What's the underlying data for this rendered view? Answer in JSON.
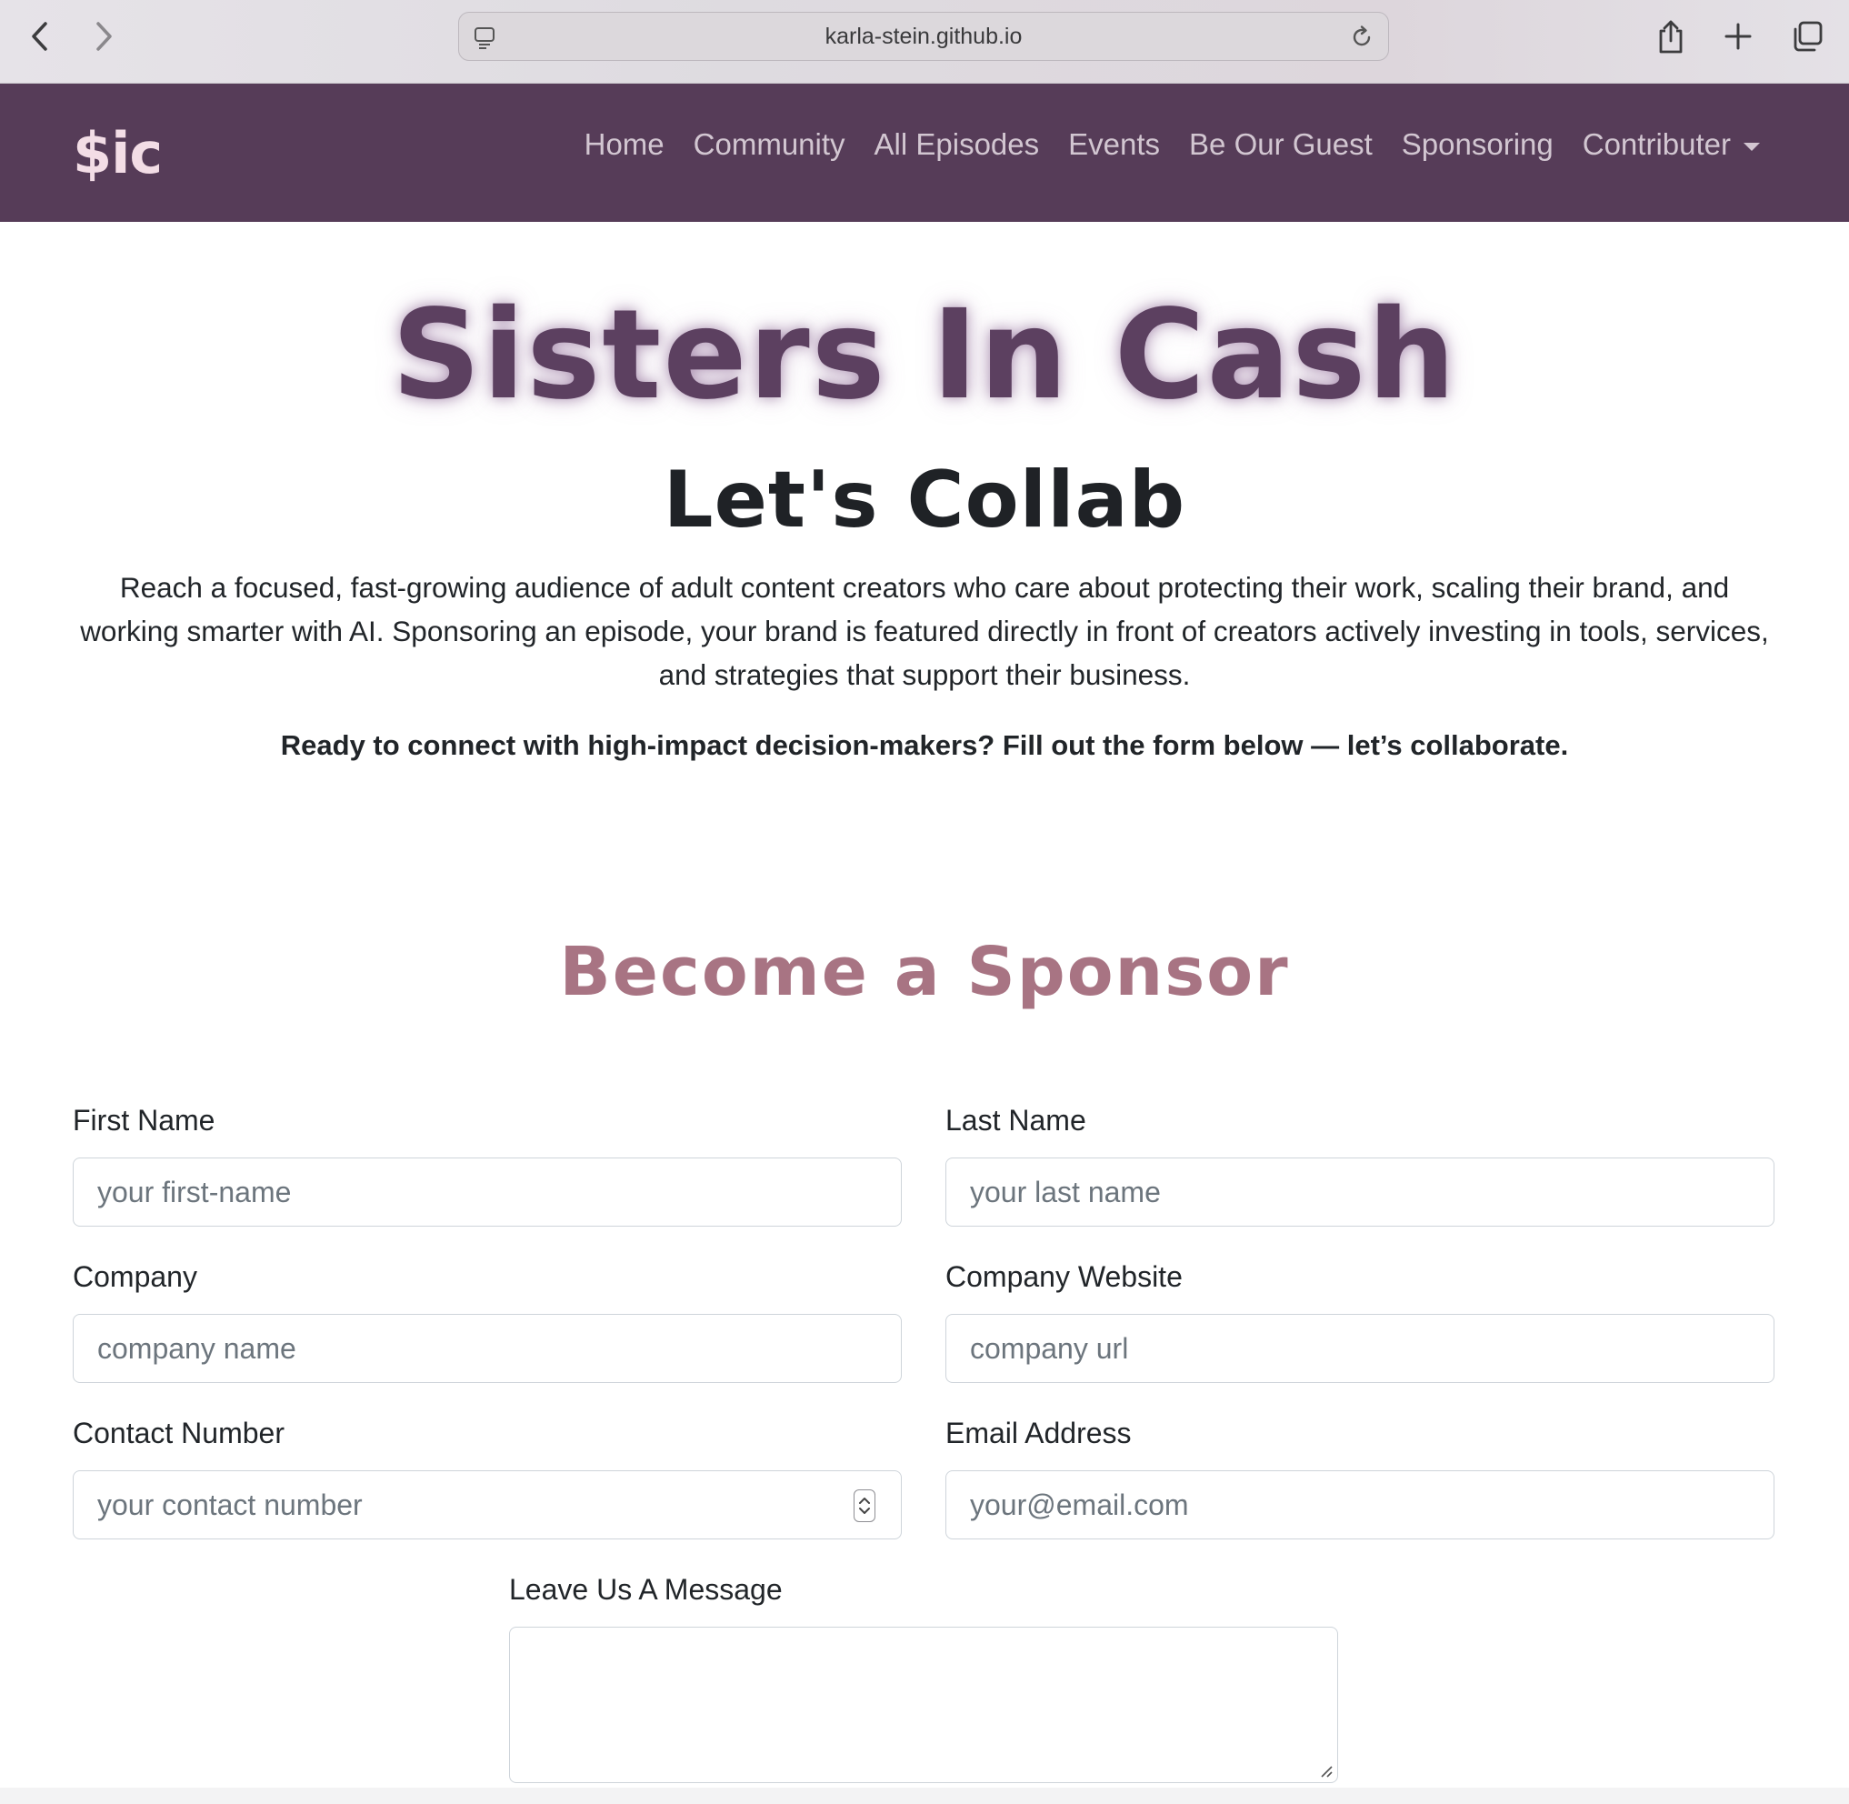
{
  "browser": {
    "url": "karla-stein.github.io",
    "icons": [
      "back-icon",
      "forward-icon",
      "page-icon",
      "reload-icon",
      "share-icon",
      "new-tab-icon",
      "tabs-icon"
    ]
  },
  "navbar": {
    "brand": "$ic",
    "links": [
      "Home",
      "Community",
      "All Episodes",
      "Events",
      "Be Our Guest",
      "Sponsoring",
      "Contributer"
    ],
    "colors": {
      "background": "#563c58",
      "brand": "#f3dde6",
      "link": "#d2c6d1"
    }
  },
  "hero": {
    "title": "Sisters In Cash",
    "subtitle": "Let's Collab",
    "intro": "Reach a focused, fast-growing audience of adult content creators who care about protecting their work, scaling their brand, and working smarter with AI. Sponsoring an episode, your brand is featured directly in front of creators actively investing in tools, services, and strategies that support their business.",
    "cta": "Ready to connect with high-impact decision-makers? Fill out the form below — let’s collaborate.",
    "colors": {
      "title": "#5c4060"
    }
  },
  "form": {
    "title": "Become a Sponsor",
    "title_color": "#a87483",
    "first_name": {
      "label": "First Name",
      "placeholder": "your first-name"
    },
    "last_name": {
      "label": "Last Name",
      "placeholder": "your last name"
    },
    "company": {
      "label": "Company",
      "placeholder": "company name"
    },
    "company_website": {
      "label": "Company Website",
      "placeholder": "company url"
    },
    "contact_number": {
      "label": "Contact Number",
      "placeholder": "your contact number"
    },
    "email": {
      "label": "Email Address",
      "placeholder": "your@email.com"
    },
    "message": {
      "label": "Leave Us A Message",
      "value": ""
    }
  }
}
